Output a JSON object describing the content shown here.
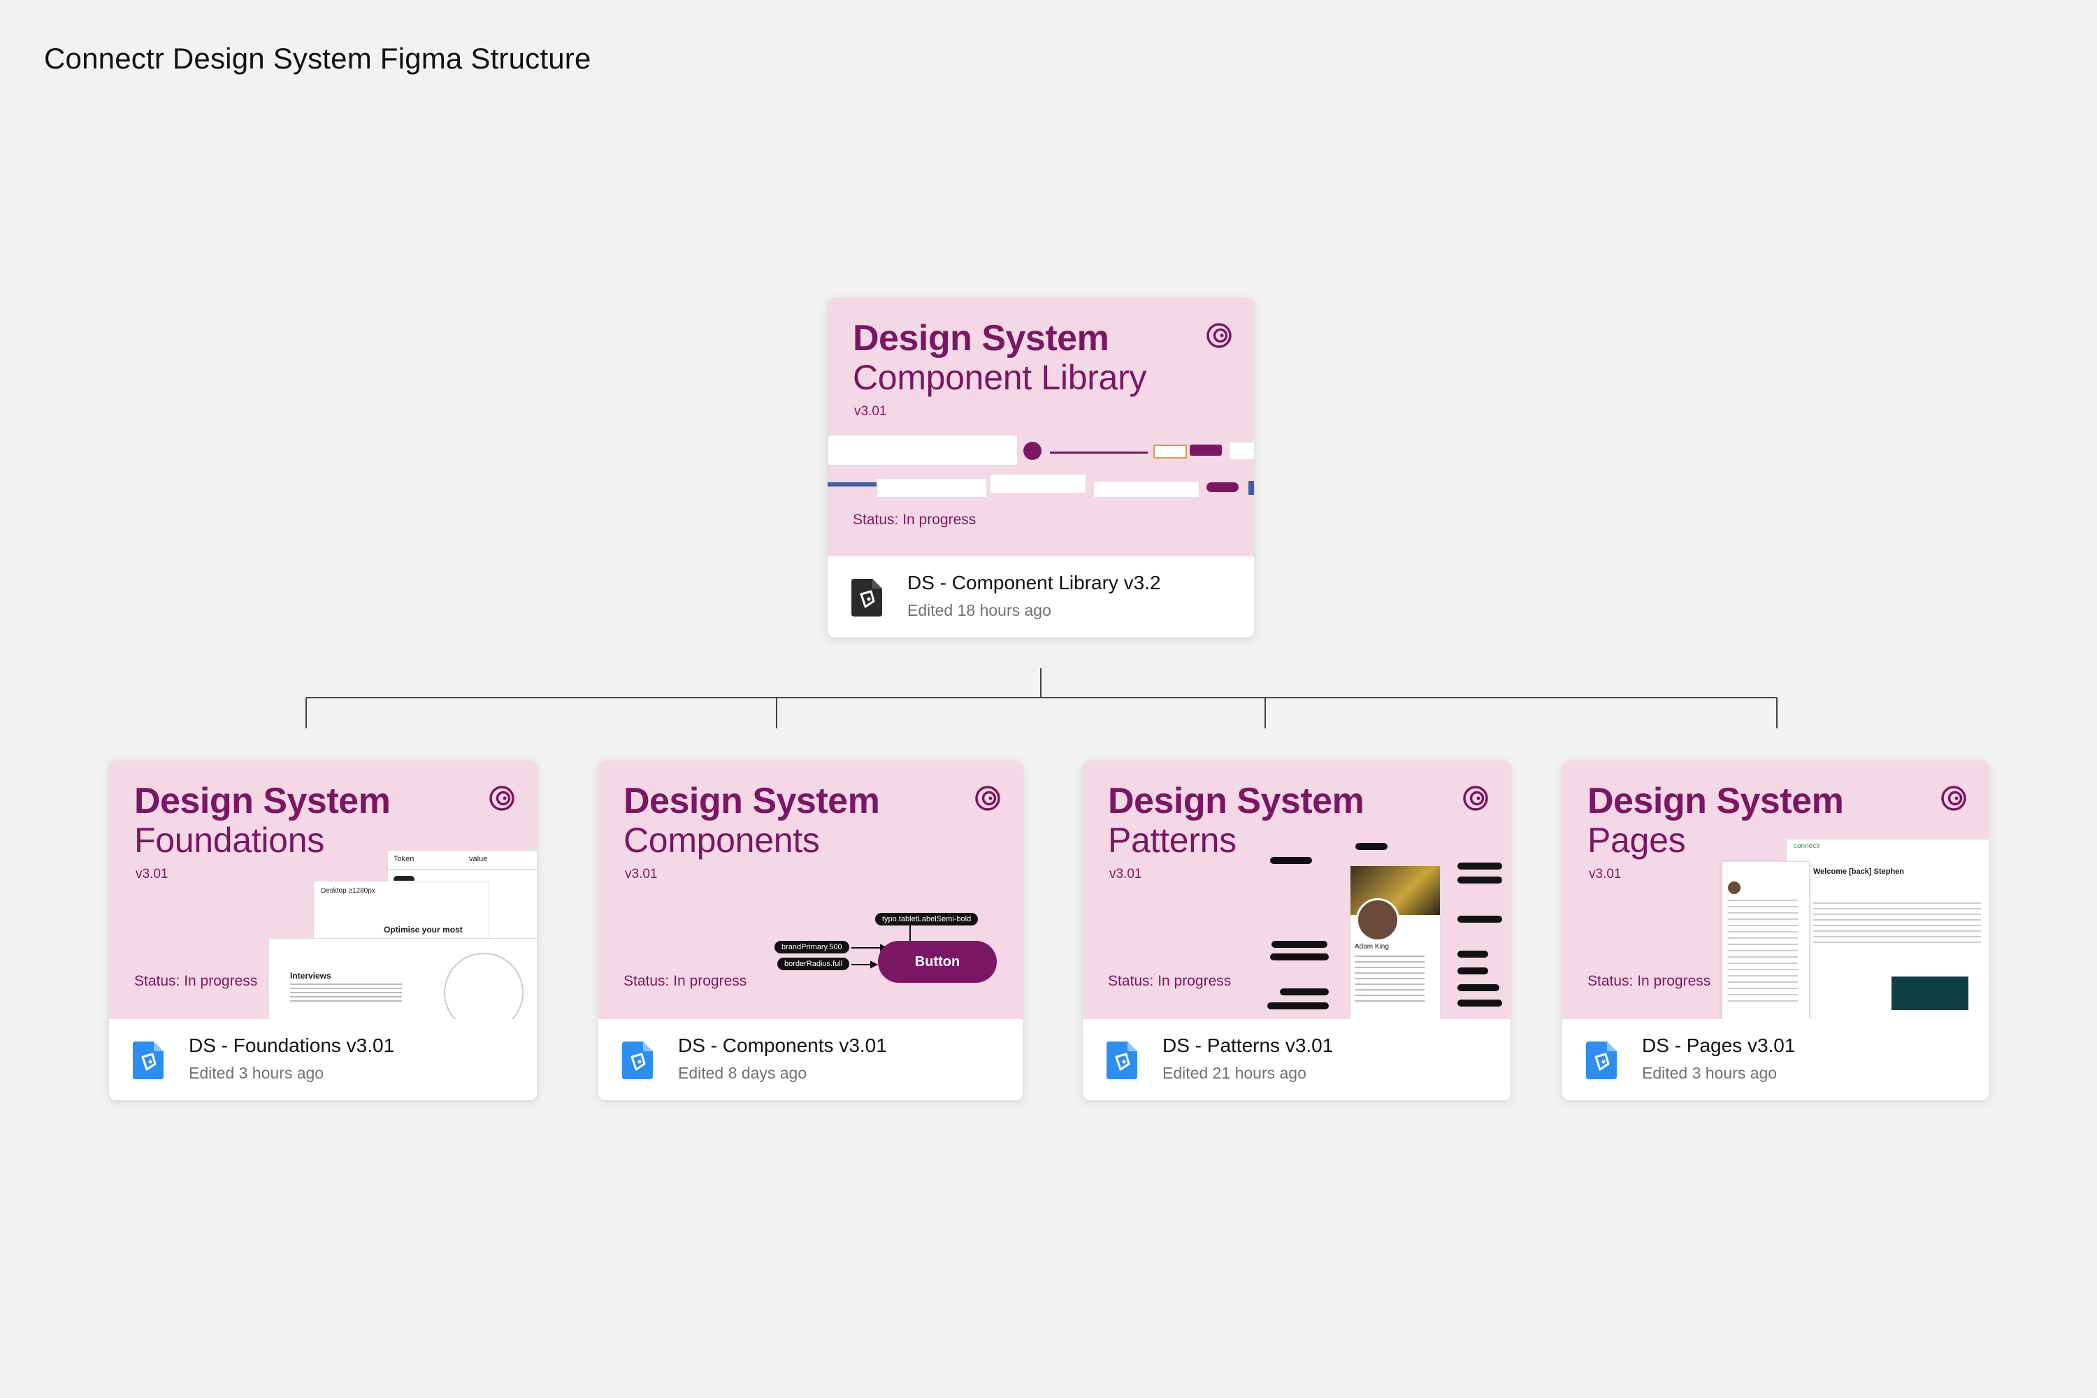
{
  "page": {
    "title": "Connectr Design System Figma Structure"
  },
  "colors": {
    "background": "#f2f2f2",
    "thumb": "#f5d8e6",
    "brand": "#7b1664",
    "file_icon_blue": "#2d8ef0",
    "file_icon_dark": "#2b2b2b"
  },
  "cards": {
    "library": {
      "title_line1": "Design System",
      "title_line2": "Component Library",
      "version": "v3.01",
      "status": "Status: In progress",
      "file_name": "DS - Component Library v3.2",
      "edited": "Edited 18 hours ago",
      "icon": "figma-file-dark-icon"
    },
    "foundations": {
      "title_line1": "Design System",
      "title_line2": "Foundations",
      "version": "v3.01",
      "status": "Status: In progress",
      "file_name": "DS - Foundations v3.01",
      "edited": "Edited 3 hours ago",
      "icon": "figma-file-blue-icon",
      "preview": {
        "token_header": "Token",
        "value_header": "value",
        "desktop_label": "Desktop ≥1280px",
        "interviews": "Interviews",
        "optimise": "Optimise your most"
      }
    },
    "components": {
      "title_line1": "Design System",
      "title_line2": "Components",
      "version": "v3.01",
      "status": "Status: In progress",
      "file_name": "DS - Components v3.01",
      "edited": "Edited 8 days ago",
      "icon": "figma-file-blue-icon",
      "preview": {
        "token_label": "typo.tabletLabelSemi-bold",
        "color_token": "brandPrimary.500",
        "radius_token": "borderRadius.full",
        "button_label": "Button"
      }
    },
    "patterns": {
      "title_line1": "Design System",
      "title_line2": "Patterns",
      "version": "v3.01",
      "status": "Status: In progress",
      "file_name": "DS - Patterns v3.01",
      "edited": "Edited 21 hours ago",
      "icon": "figma-file-blue-icon",
      "preview": {
        "person_name": "Adam King"
      }
    },
    "pages": {
      "title_line1": "Design System",
      "title_line2": "Pages",
      "version": "v3.01",
      "status": "Status: In progress",
      "file_name": "DS - Pages v3.01",
      "edited": "Edited 3 hours ago",
      "icon": "figma-file-blue-icon",
      "preview": {
        "brand": "connectr",
        "welcome": "Welcome [back] Stephen"
      }
    }
  }
}
